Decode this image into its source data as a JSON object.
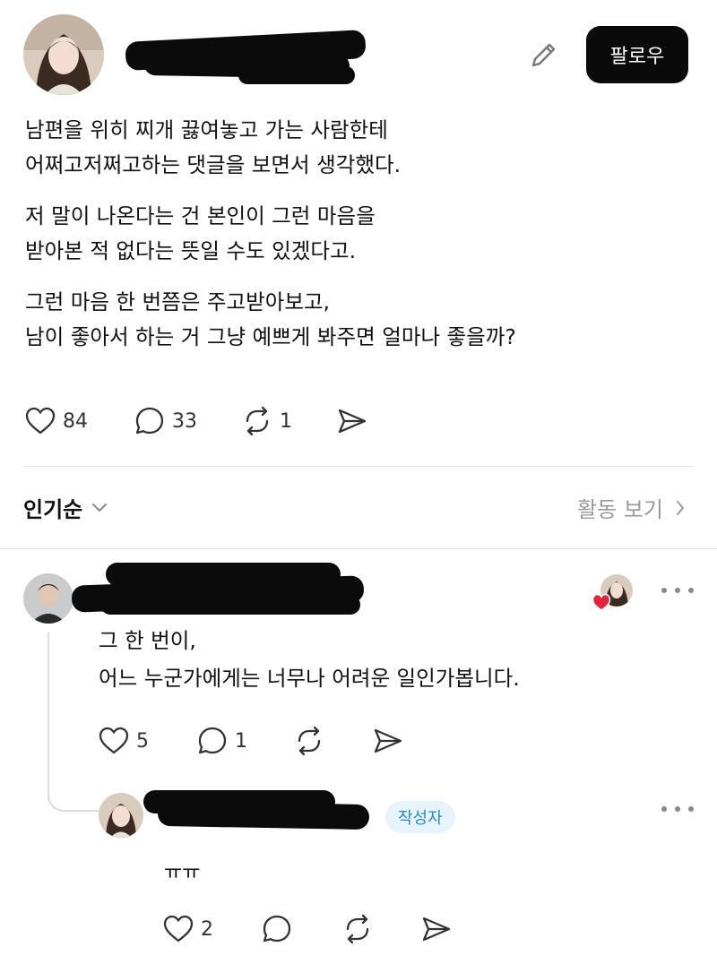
{
  "post": {
    "follow_label": "팔로우",
    "paragraphs": [
      [
        "남편을 위히 찌개 끓여놓고 가는 사람한테",
        "어쩌고저쩌고하는 댓글을 보면서 생각했다."
      ],
      [
        "저 말이 나온다는 건 본인이 그런 마음을",
        "받아본 적 없다는 뜻일 수도 있겠다고."
      ],
      [
        "그런 마음 한 번쯤은 주고받아보고,",
        "남이 좋아서 하는 거 그냥 예쁘게 봐주면 얼마나 좋을까?"
      ]
    ],
    "stats": {
      "likes": "84",
      "comments": "33",
      "reposts": "1"
    }
  },
  "sort": {
    "label": "인기순",
    "activity_label": "활동 보기"
  },
  "comment": {
    "lines": [
      "그 한 번이,",
      "어느 누군가에게는 너무나 어려운 일인가봅니다."
    ],
    "stats": {
      "likes": "5",
      "comments": "1"
    }
  },
  "reply": {
    "author_badge": "작성자",
    "text": "ㅠㅠ",
    "stats": {
      "likes": "2"
    }
  },
  "icons": {
    "edit": "pencil-icon",
    "like": "heart-icon",
    "comment": "comment-bubble-icon",
    "repost": "repost-icon",
    "share": "send-icon",
    "chevron": "chevron-down-icon",
    "more": "more-dots-icon"
  },
  "colors": {
    "follow_bg": "#0a0a0a",
    "badge_bg": "#e8f4fc",
    "badge_text": "#2a88c8",
    "liked_heart": "#e0243c"
  }
}
